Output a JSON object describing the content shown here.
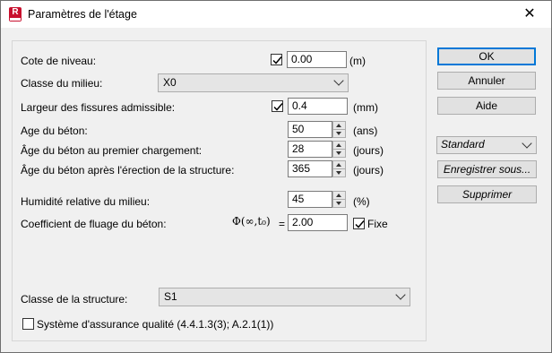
{
  "window": {
    "title": "Paramètres de l'étage",
    "app_icon_letter": "R",
    "close_symbol": "✕"
  },
  "form": {
    "cote_niveau": {
      "label": "Cote de niveau:",
      "checked": true,
      "value": "0.00",
      "unit": "(m)"
    },
    "classe_milieu": {
      "label": "Classe du milieu:",
      "selected": "X0"
    },
    "largeur_fissures": {
      "label": "Largeur des fissures admissible:",
      "checked": true,
      "value": "0.4",
      "unit": "(mm)"
    },
    "age_beton": {
      "label": "Age du béton:",
      "value": "50",
      "unit": "(ans)"
    },
    "age_premier_chargement": {
      "label": "Âge du béton au premier chargement:",
      "value": "28",
      "unit": "(jours)"
    },
    "age_erection": {
      "label": "Âge du béton après l'érection de la structure:",
      "value": "365",
      "unit": "(jours)"
    },
    "humidite": {
      "label": "Humidité relative du milieu:",
      "value": "45",
      "unit": "(%)"
    },
    "fluage": {
      "label": "Coefficient de fluage du béton:",
      "symbol": "Φ(∞,t₀)",
      "equals": "=",
      "value": "2.00",
      "fixe_label": "Fixe",
      "fixe_checked": true
    },
    "classe_structure": {
      "label": "Classe de la structure:",
      "selected": "S1"
    },
    "assurance_qualite": {
      "label": "Système d'assurance qualité (4.4.1.3(3); A.2.1(1))",
      "checked": false
    }
  },
  "buttons": {
    "ok": "OK",
    "annuler": "Annuler",
    "aide": "Aide",
    "standard_select": "Standard",
    "enregistrer": "Enregistrer sous...",
    "supprimer": "Supprimer"
  }
}
